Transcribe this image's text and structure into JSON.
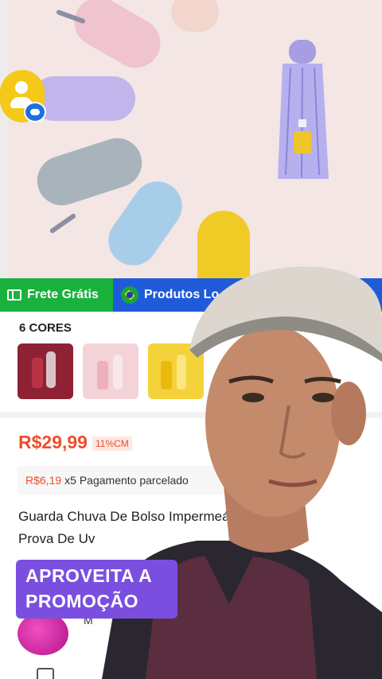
{
  "promo_strip": {
    "free_shipping_label": "Frete Grátis",
    "local_products_label": "Produtos Lo"
  },
  "colors": {
    "title": "6 CORES",
    "swatches": [
      {
        "name": "vinho",
        "color": "#9e2a3c"
      },
      {
        "name": "rosa",
        "color": "#f0c9cf"
      },
      {
        "name": "amarelo",
        "color": "#f1cc22"
      }
    ]
  },
  "product": {
    "price": "R$29,99",
    "discount": "11%CM",
    "installment_amount": "R$6,19",
    "installment_text": "x5 Pagamento parcelado",
    "title": "Guarda Chuva De Bolso Impermeáv Prova De Uv"
  },
  "overlay": {
    "caption": "APROVEITA A PROMOÇÃO"
  },
  "shop": {
    "name_initial": "M"
  },
  "theme": {
    "accent": "#ee4d2d",
    "free_shipping_bg": "#19b23c",
    "local_bg": "#1f5bd9",
    "caption_bg": "#7a4fe0"
  }
}
